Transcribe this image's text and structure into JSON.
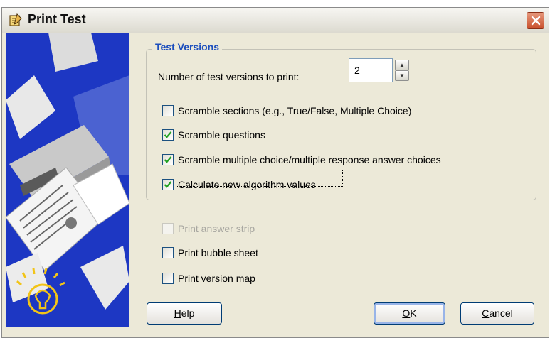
{
  "window": {
    "title": "Print Test"
  },
  "group": {
    "title": "Test Versions",
    "versions_label": "Number of test versions to print:",
    "versions_value": "2",
    "options": [
      {
        "label": "Scramble sections (e.g., True/False, Multiple Choice)",
        "checked": false
      },
      {
        "label": "Scramble questions",
        "checked": true
      },
      {
        "label": "Scramble multiple choice/multiple response answer choices",
        "checked": true
      },
      {
        "label": "Calculate new algorithm values",
        "checked": true
      }
    ]
  },
  "extras": [
    {
      "label": "Print answer strip",
      "checked": false,
      "enabled": false
    },
    {
      "label": "Print bubble sheet",
      "checked": false,
      "enabled": true
    },
    {
      "label": "Print version map",
      "checked": false,
      "enabled": true
    }
  ],
  "buttons": {
    "help": {
      "mnemonic": "H",
      "rest": "elp"
    },
    "ok": {
      "mnemonic": "O",
      "rest": "K"
    },
    "cancel": {
      "mnemonic": "C",
      "rest": "ancel"
    }
  },
  "colors": {
    "accent": "#1c4ebd",
    "sidebar": "#1d37c3",
    "dialog": "#ece9d8",
    "close": "#c9502d"
  },
  "icons": [
    "print-test-icon",
    "close-icon",
    "printer-illustration",
    "lightbulb-icon",
    "checkmark-icon",
    "spin-up-icon",
    "spin-down-icon"
  ]
}
